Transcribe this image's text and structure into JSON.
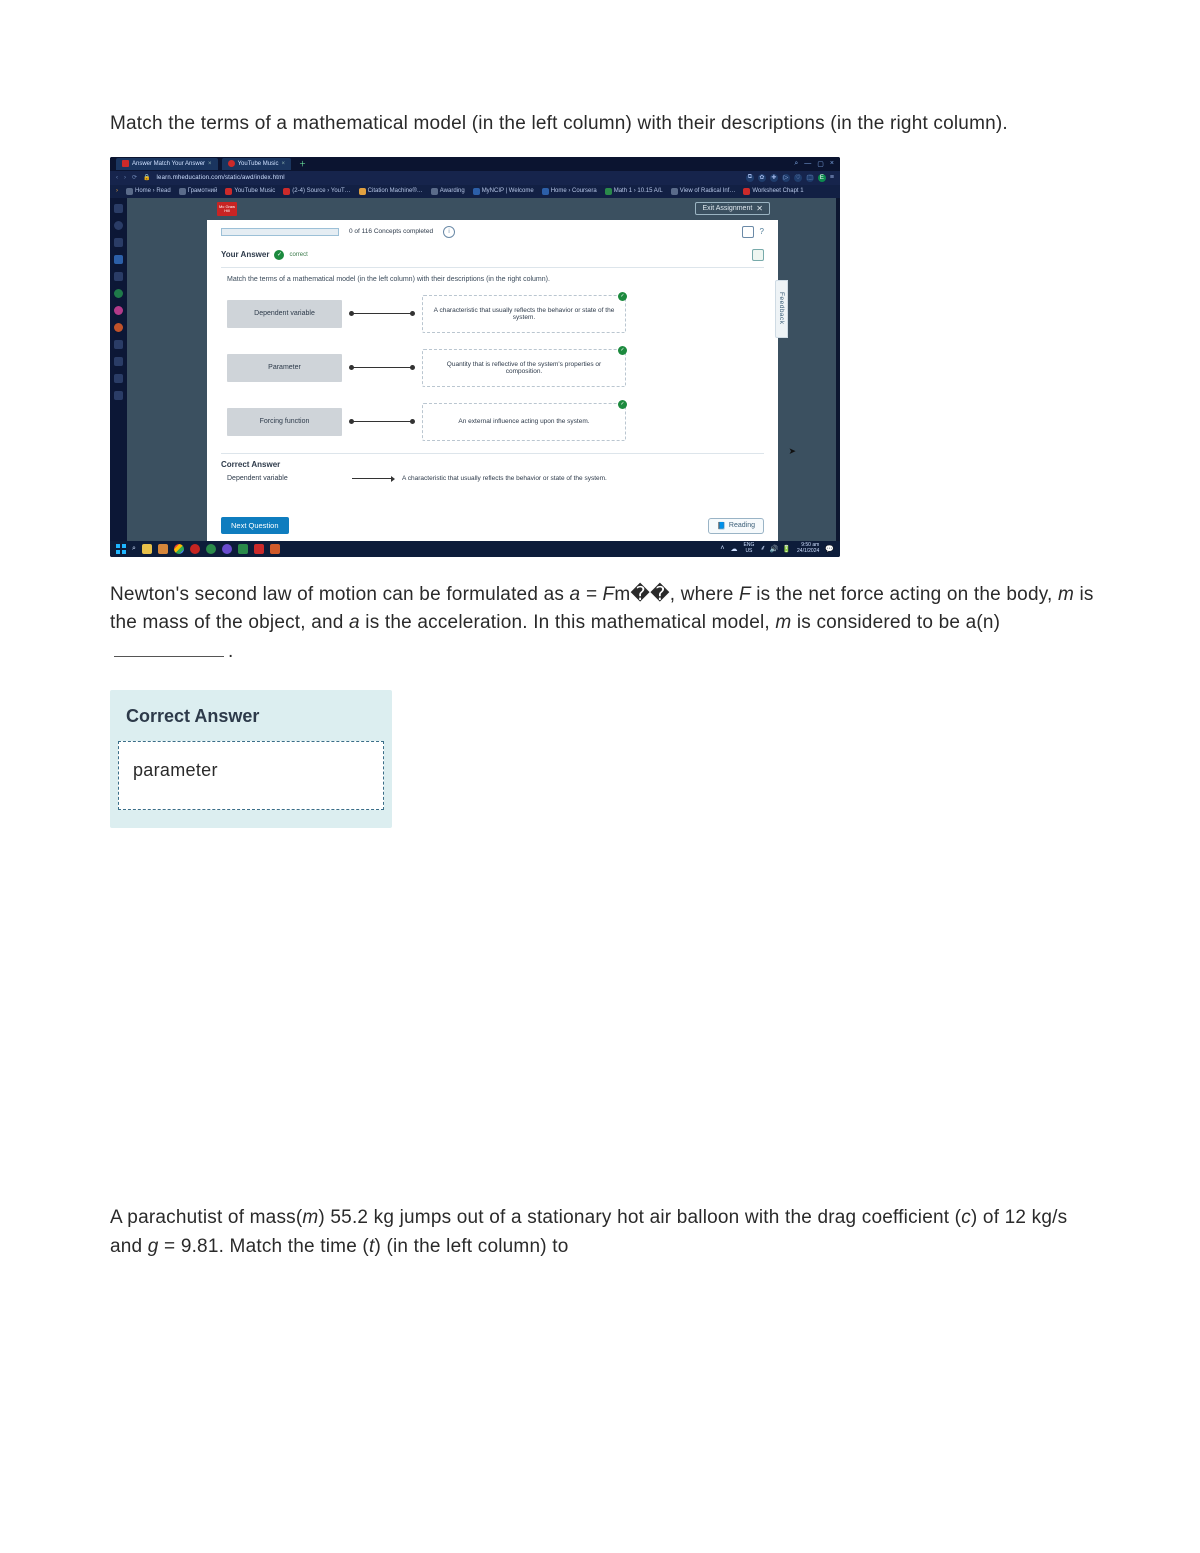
{
  "question1": {
    "text": "Match the terms of a mathematical model (in the left column) with their descriptions (in the right column)."
  },
  "browser": {
    "tabs": [
      {
        "title": "Answer Match Your Answer",
        "close": "×"
      },
      {
        "title": "YouTube Music",
        "close": "×"
      }
    ],
    "window_controls": {
      "min": "—",
      "max": "▢",
      "close": "×"
    },
    "nav": {
      "back": "‹",
      "fwd": "›",
      "reload": "⟳",
      "lock": "🔒"
    },
    "url": "learn.mheducation.com/static/awd/index.html",
    "addr_icons": [
      "⧉",
      "✿",
      "✚",
      "▷",
      "♡",
      "⬚",
      "E"
    ],
    "bookmarks": [
      "Home › Read",
      "Грамотний",
      "YouTube Music",
      "(2-4) Source › YouT…",
      "Citation Machine®…",
      "Awarding",
      "MyNCIP | Welcome",
      "Home › Coursera",
      "Math 1 › 10.15 A/L",
      "View of Radical Inf…",
      "Worksheet Chapt 1"
    ]
  },
  "app": {
    "logo": "Mc Graw Hill",
    "exit": "Exit Assignment",
    "progress_text": "0 of 116 Concepts completed",
    "your_answer_label": "Your Answer",
    "your_answer_status": "correct",
    "instructions": "Match the terms of a mathematical model (in the left column) with their descriptions (in the right column).",
    "matches": [
      {
        "term": "Dependent variable",
        "desc": "A characteristic that usually reflects the behavior or state of the system."
      },
      {
        "term": "Parameter",
        "desc": "Quantity that is reflective of the system's properties or composition."
      },
      {
        "term": "Forcing function",
        "desc": "An external influence acting upon the system."
      }
    ],
    "correct_answer_label": "Correct Answer",
    "correct_answer_row": {
      "term": "Dependent variable",
      "desc": "A characteristic that usually reflects the behavior or state of the system."
    },
    "next_button": "Next Question",
    "reading_button": "Reading",
    "feedback_tab": "Feedback"
  },
  "taskbar": {
    "lang_line1": "ENG",
    "lang_line2": "US",
    "time": "9:50 am",
    "date": "24/1/2024"
  },
  "question2": {
    "prefix": "Newton's second law of motion can be formulated as ",
    "eq": "a = F",
    "eq_mid": "m",
    "eq_suffix": "�",
    "eq_suffix2": "�",
    "p2": ", where ",
    "F": "F",
    "p3": " is the net force acting on the body, ",
    "m": "m",
    "p4": " is the mass of the object, and ",
    "a": "a",
    "p5": " is the acceleration. In this mathematical model, ",
    "m2": "m",
    "p6": " is considered to be a(n) ",
    "p7": "."
  },
  "answer_card": {
    "title": "Correct Answer",
    "value": "parameter"
  },
  "question3": {
    "p1": "A parachutist of mass(",
    "m": "m",
    "p2": ") 55.2 kg jumps out of a stationary hot air balloon with the drag coefficient (",
    "c": "c",
    "p3": ") of 12 kg/s and ",
    "g": "g",
    "p4": " = 9.81. Match the time (",
    "t": "t",
    "p5": ") (in the left column) to"
  }
}
